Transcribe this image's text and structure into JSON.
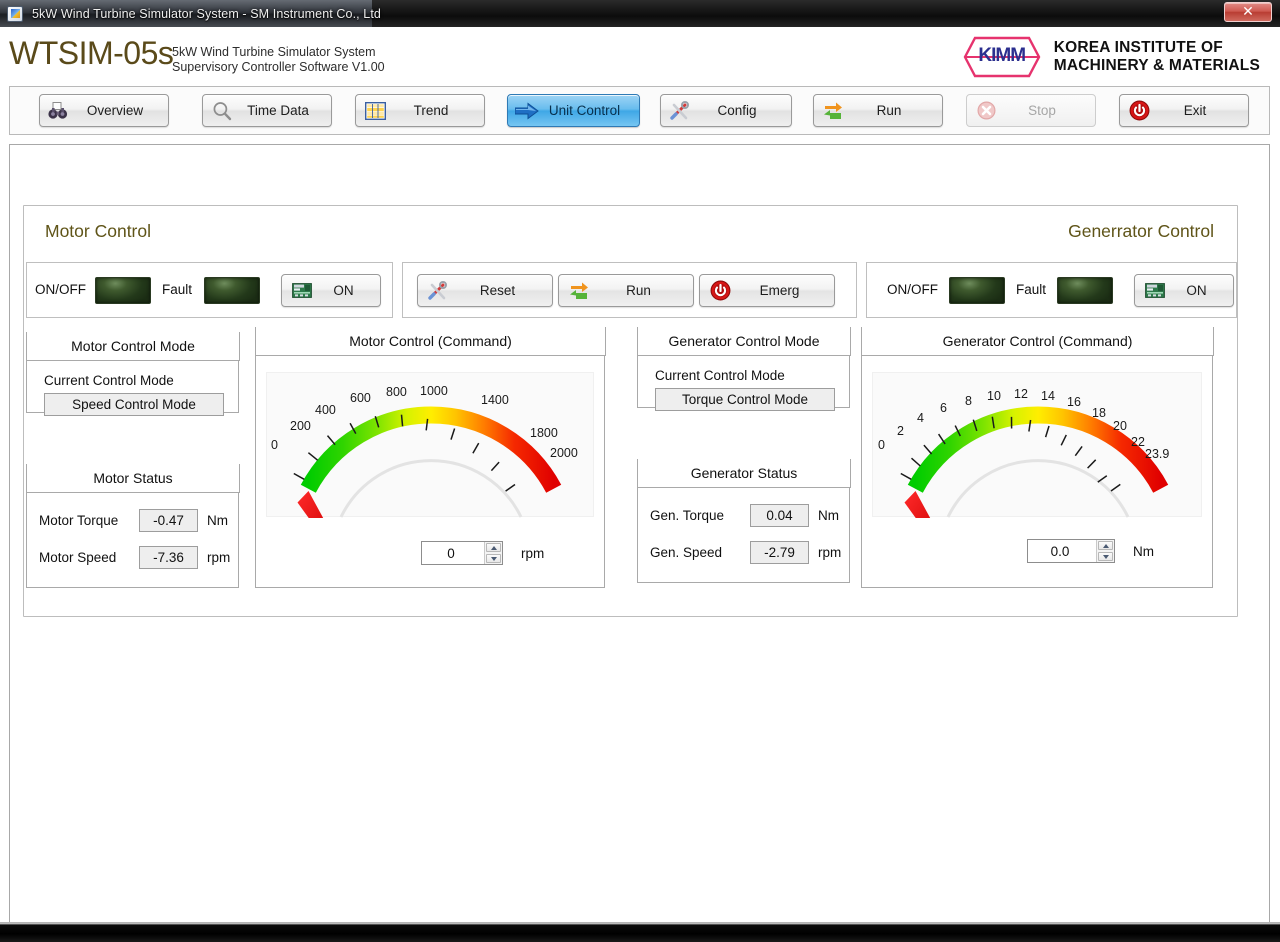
{
  "window": {
    "title": "5kW Wind Turbine Simulator System - SM Instrument Co., Ltd",
    "close_label": "✕"
  },
  "header": {
    "brand": "WTSIM-05s",
    "subtitle_line1": "5kW Wind Turbine Simulator System",
    "subtitle_line2": "Supervisory Controller Software V1.00",
    "logo_text": "KIMM",
    "org_line1": "KOREA INSTITUTE OF",
    "org_line2": "MACHINERY & MATERIALS"
  },
  "toolbar": {
    "buttons": [
      {
        "label": "Overview",
        "icon": "binoculars-icon",
        "state": "normal"
      },
      {
        "label": "Time Data",
        "icon": "magnifier-icon",
        "state": "normal"
      },
      {
        "label": "Trend",
        "icon": "table-icon",
        "state": "normal"
      },
      {
        "label": "Unit Control",
        "icon": "arrow-right-icon",
        "state": "active"
      },
      {
        "label": "Config",
        "icon": "tools-icon",
        "state": "normal"
      },
      {
        "label": "Run",
        "icon": "recycle-icon",
        "state": "normal"
      },
      {
        "label": "Stop",
        "icon": "stop-x-icon",
        "state": "disabled"
      },
      {
        "label": "Exit",
        "icon": "power-icon",
        "state": "normal"
      }
    ]
  },
  "unit_control": {
    "motor": {
      "title": "Motor Control",
      "onoff_label": "ON/OFF",
      "onoff_state": "off",
      "fault_label": "Fault",
      "fault_state": "off",
      "on_button": "ON",
      "mode_panel": {
        "legend": "Motor Control Mode",
        "current_label": "Current Control Mode",
        "current_value": "Speed Control Mode"
      },
      "status_panel": {
        "legend": "Motor Status",
        "rows": [
          {
            "label": "Motor Torque",
            "value": "-0.47",
            "unit": "Nm"
          },
          {
            "label": "Motor Speed",
            "value": "-7.36",
            "unit": "rpm"
          }
        ]
      },
      "command_panel": {
        "legend": "Motor Control (Command)",
        "setpoint": "0",
        "unit": "rpm"
      }
    },
    "middle_buttons": [
      {
        "label": "Reset",
        "icon": "tools-icon"
      },
      {
        "label": "Run",
        "icon": "recycle-icon"
      },
      {
        "label": "Emerg",
        "icon": "power-icon"
      }
    ],
    "generator": {
      "title": "Generrator Control",
      "onoff_label": "ON/OFF",
      "onoff_state": "off",
      "fault_label": "Fault",
      "fault_state": "off",
      "on_button": "ON",
      "mode_panel": {
        "legend": "Generator Control Mode",
        "current_label": "Current Control Mode",
        "current_value": "Torque Control Mode"
      },
      "status_panel": {
        "legend": "Generator Status",
        "rows": [
          {
            "label": "Gen. Torque",
            "value": "0.04",
            "unit": "Nm"
          },
          {
            "label": "Gen. Speed",
            "value": "-2.79",
            "unit": "rpm"
          }
        ]
      },
      "command_panel": {
        "legend": "Generator Control (Command)",
        "setpoint": "0.0",
        "unit": "Nm"
      }
    }
  },
  "chart_data": [
    {
      "type": "gauge",
      "name": "motor-speed-gauge",
      "title": "Motor Control (Command)",
      "unit": "rpm",
      "min": 0,
      "max": 2000,
      "value": 0,
      "needle_value": -70,
      "tick_labels": [
        "0",
        "200",
        "400",
        "600",
        "800",
        "1000",
        "1400",
        "1800",
        "2000"
      ],
      "tick_values": [
        0,
        200,
        400,
        600,
        800,
        1000,
        1400,
        1800,
        2000
      ],
      "minor_step": 200,
      "colors": [
        "#00d200",
        "#7ae000",
        "#d8f000",
        "#ffee00",
        "#ffb300",
        "#ff6000",
        "#f00000",
        "#e00000"
      ]
    },
    {
      "type": "gauge",
      "name": "generator-torque-gauge",
      "title": "Generator Control (Command)",
      "unit": "Nm",
      "min": 0,
      "max": 23.9,
      "value": 0.0,
      "needle_value": -0.85,
      "tick_labels": [
        "0",
        "2",
        "4",
        "6",
        "8",
        "10",
        "12",
        "14",
        "16",
        "18",
        "20",
        "22",
        "23.9"
      ],
      "tick_values": [
        0,
        2,
        4,
        6,
        8,
        10,
        12,
        14,
        16,
        18,
        20,
        22,
        23.9
      ],
      "minor_step": 2,
      "colors": [
        "#00d200",
        "#7ae000",
        "#d8f000",
        "#ffee00",
        "#ffb300",
        "#ff6000",
        "#f00000",
        "#e00000"
      ]
    }
  ],
  "colors": {
    "accent_blue": "#3fa7e6",
    "brand_gold": "#5f5418",
    "kimm_blue": "#2b2f8f",
    "kimm_pink": "#e6336e",
    "led_off": "#23391a",
    "needle_red": "#ee0000"
  }
}
